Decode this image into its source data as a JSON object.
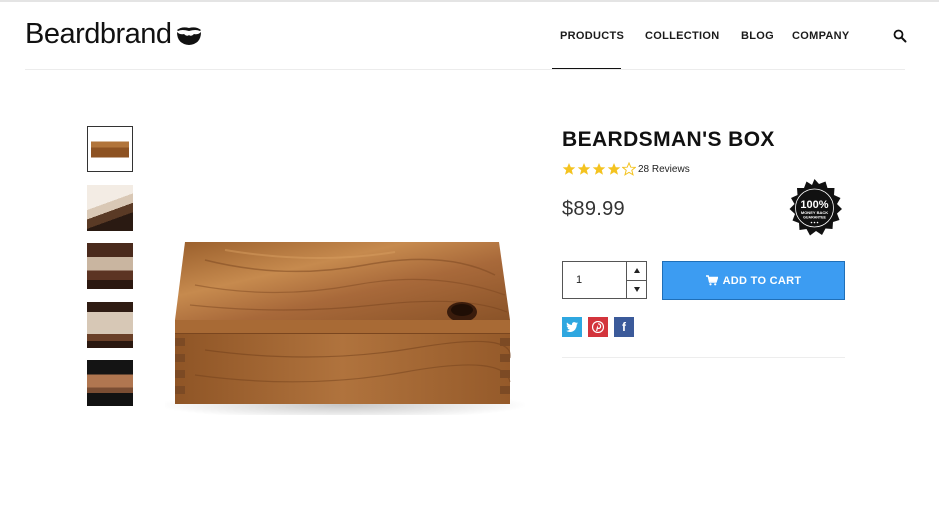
{
  "brand": {
    "logo_text": "Beardbrand",
    "logo_icon": "beard-icon"
  },
  "nav": {
    "items": [
      {
        "label": "PRODUCTS",
        "active": true
      },
      {
        "label": "COLLECTION",
        "active": false
      },
      {
        "label": "BLOG",
        "active": false
      },
      {
        "label": "COMPANY",
        "active": false
      }
    ],
    "search_icon": "search-icon"
  },
  "gallery": {
    "thumbnails": [
      {
        "name": "box-top-view",
        "selected": true
      },
      {
        "name": "box-lid-closeup",
        "selected": false
      },
      {
        "name": "box-lifestyle-dark",
        "selected": false
      },
      {
        "name": "box-open-view",
        "selected": false
      },
      {
        "name": "box-dark-background",
        "selected": false
      }
    ]
  },
  "product": {
    "title": "BEARDSMAN'S BOX",
    "rating": 4,
    "rating_max": 5,
    "reviews_text": "28 Reviews",
    "price": "$89.99",
    "badge": {
      "line1": "100%",
      "line2": "MONEY BACK",
      "line3": "GUARANTEE"
    },
    "quantity": "1",
    "add_to_cart_label": "ADD TO CART"
  },
  "share": [
    {
      "network": "twitter",
      "glyph": "t",
      "color": "#2ea7e0"
    },
    {
      "network": "pinterest",
      "glyph": "p",
      "color": "#d3343c"
    },
    {
      "network": "facebook",
      "glyph": "f",
      "color": "#3b5a9a"
    }
  ],
  "colors": {
    "accent": "#3c9cf2",
    "star": "#f4c320"
  }
}
